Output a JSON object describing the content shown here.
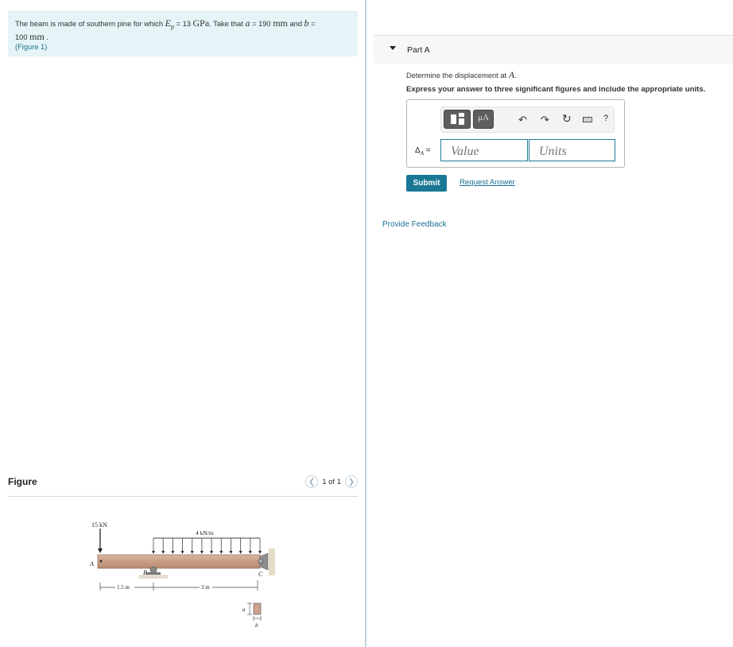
{
  "problem": {
    "text_1": "The beam is made of southern pine for which ",
    "E_symbol": "E",
    "E_sub": "p",
    "text_2": " = 13 ",
    "E_unit": "GPa",
    "text_3": ". Take that ",
    "a_symbol": "a",
    "text_4": " = 190 ",
    "a_unit": "mm",
    "text_5": " and ",
    "b_symbol": "b",
    "text_6": " =",
    "b_value": "100 ",
    "b_unit": "mm",
    "text_7": " .",
    "figure_link": "(Figure 1)"
  },
  "figure": {
    "title": "Figure",
    "pager_text": "1 of 1",
    "prev_icon": "chevron-left-icon",
    "next_icon": "chevron-right-icon",
    "labels": {
      "force": "15 kN",
      "distributed": "4 kN/m",
      "point_a": "A",
      "point_b": "B",
      "point_c": "C",
      "dim_1": "1.5 m",
      "dim_2": "3 m",
      "section_a": "a",
      "section_b": "b"
    }
  },
  "part": {
    "title": "Part A",
    "question_prefix": "Determine the displacement at ",
    "question_var": "A",
    "question_suffix": ".",
    "instruction": "Express your answer to three significant figures and include the appropriate units.",
    "toolbar": {
      "template_icon": "templates-icon",
      "units_label": "μA",
      "undo_icon": "undo-icon",
      "redo_icon": "redo-icon",
      "reset_icon": "reset-icon",
      "keyboard_icon": "keyboard-icon",
      "help_label": "?"
    },
    "answer_label": "Δ",
    "answer_label_sub": "A",
    "answer_label_eq": " =",
    "value_placeholder": "Value",
    "units_placeholder": "Units",
    "submit_label": "Submit",
    "request_answer_label": "Request Answer"
  },
  "feedback_label": "Provide Feedback"
}
